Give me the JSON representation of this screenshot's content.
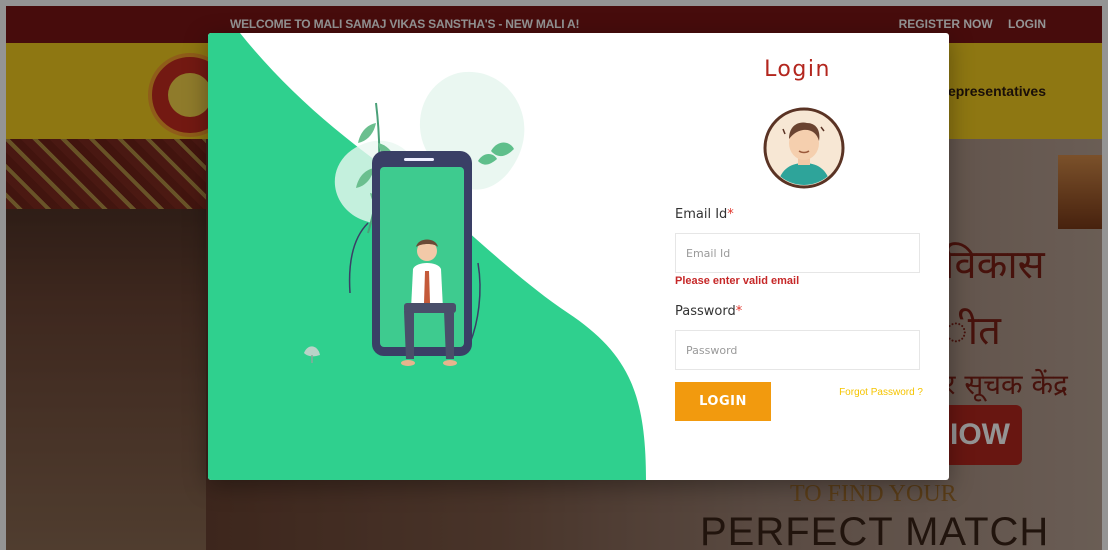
{
  "topbar": {
    "marquee": "WELCOME TO MALI SAMAJ VIKAS SANSTHA'S - NEW MALI A!",
    "register_label": "REGISTER NOW",
    "login_label": "LOGIN"
  },
  "navbar": {
    "visible_item": "epresentatives"
  },
  "hero": {
    "line1": "विकास",
    "line2": "ीत",
    "line3": "र सूचक केंद्र",
    "cta": "IOW",
    "line5": "TO FIND YOUR",
    "line6": "PERFECT MATCH"
  },
  "login_modal": {
    "title": "Login",
    "email_label": "Email Id",
    "email_required": "*",
    "email_placeholder": "Email Id",
    "email_value": "",
    "email_error": "Please enter valid email",
    "password_label": "Password",
    "password_required": "*",
    "password_placeholder": "Password",
    "password_value": "",
    "login_button": "LOGIN",
    "forgot_password": "Forgot Password ?"
  },
  "colors": {
    "topbar": "#7a1515",
    "navbar": "#f4ce1f",
    "title": "#b3261e",
    "accent_green": "#2fd08e",
    "login_button": "#f29a0e",
    "forgot_link": "#f5c400",
    "error": "#c62828"
  },
  "icons": {
    "avatar": "user-avatar-icon",
    "illustration": "phone-person-illustration"
  }
}
